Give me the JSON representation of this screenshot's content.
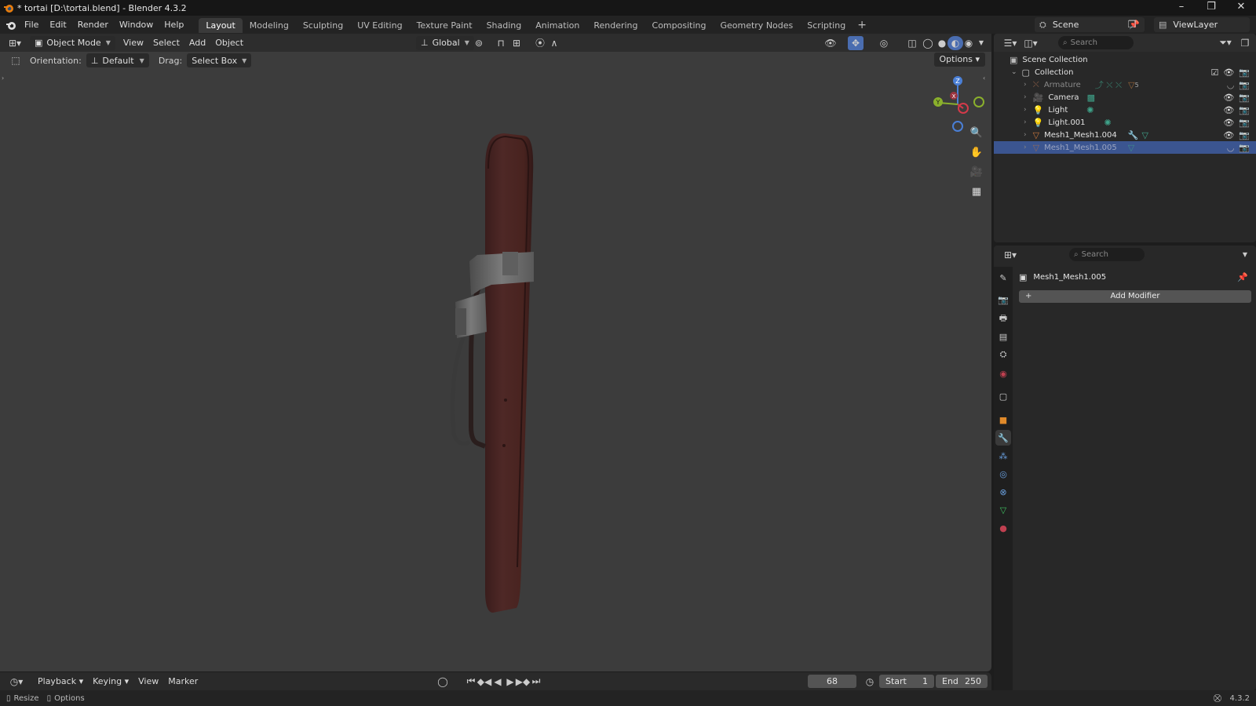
{
  "window": {
    "title": "* tortai [D:\\tortai.blend] - Blender 4.3.2",
    "controls": [
      "–",
      "❐",
      "✕"
    ]
  },
  "menu": [
    "File",
    "Edit",
    "Render",
    "Window",
    "Help"
  ],
  "workspaces": [
    "Layout",
    "Modeling",
    "Sculpting",
    "UV Editing",
    "Texture Paint",
    "Shading",
    "Animation",
    "Rendering",
    "Compositing",
    "Geometry Nodes",
    "Scripting"
  ],
  "active_workspace": "Layout",
  "scene": {
    "name": "Scene",
    "view_layer": "ViewLayer"
  },
  "viewport": {
    "mode": "Object Mode",
    "menus": [
      "View",
      "Select",
      "Add",
      "Object"
    ],
    "transform_orientation": "Global",
    "tool_settings": {
      "orientation_label": "Orientation:",
      "orientation_value": "Default",
      "drag_label": "Drag:",
      "drag_value": "Select Box"
    },
    "options_label": "Options",
    "gizmo_axes": [
      "Z",
      "Y",
      "X"
    ]
  },
  "timeline": {
    "menus": [
      "Playback",
      "Keying",
      "View",
      "Marker"
    ],
    "current_frame": "68",
    "start_label": "Start",
    "start_value": "1",
    "end_label": "End",
    "end_value": "250"
  },
  "status_bar": {
    "left": [
      "Resize",
      "Options"
    ],
    "version": "4.3.2"
  },
  "outliner": {
    "search_placeholder": "Search",
    "root": "Scene Collection",
    "collection": "Collection",
    "items": [
      {
        "name": "Armature",
        "icon": "armature-icon"
      },
      {
        "name": "Camera",
        "icon": "camera-icon"
      },
      {
        "name": "Light",
        "icon": "light-icon"
      },
      {
        "name": "Light.001",
        "icon": "light-icon"
      },
      {
        "name": "Mesh1_Mesh1.004",
        "icon": "mesh-icon"
      },
      {
        "name": "Mesh1_Mesh1.005",
        "icon": "mesh-icon"
      }
    ],
    "armature_badge": "5",
    "selected": "Mesh1_Mesh1.005"
  },
  "properties": {
    "search_placeholder": "Search",
    "object_name": "Mesh1_Mesh1.005",
    "add_modifier_label": "Add Modifier"
  },
  "colors": {
    "accent_selected": "#3b5590",
    "belt_leather": "#4a2523",
    "buckle_metal": "#6e6e6e"
  }
}
